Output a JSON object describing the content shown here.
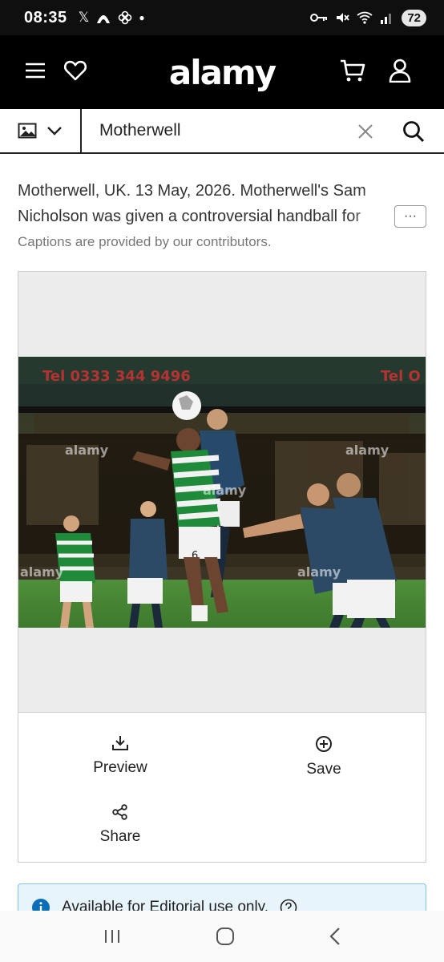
{
  "status_bar": {
    "time": "08:35",
    "battery": "72",
    "left_icons": [
      "x-icon",
      "app-icon",
      "flower-icon",
      "dot-icon"
    ],
    "right_icons": [
      "key-icon",
      "mute-icon",
      "wifi-icon",
      "signal-icon"
    ]
  },
  "header": {
    "logo": "alamy",
    "left_icons": [
      "menu-icon",
      "heart-icon"
    ],
    "right_icons": [
      "cart-icon",
      "account-icon"
    ]
  },
  "search": {
    "type_icon": "image-icon",
    "query": "Motherwell",
    "placeholder": ""
  },
  "caption": {
    "text": "Motherwell, UK. 13 May, 2026. Motherwell's Sam Nicholson was given a controversial handball for",
    "more_label": "···",
    "contributors_note": "Captions are provided by our contributors."
  },
  "image": {
    "watermarks": [
      "alamy",
      "alamy",
      "alamy",
      "alamy",
      "alamy"
    ],
    "background_color": "#ececec"
  },
  "actions": {
    "preview_label": "Preview",
    "save_label": "Save",
    "share_label": "Share"
  },
  "notice": {
    "text": "Available for Editorial use only."
  },
  "colors": {
    "header_bg": "#000000",
    "notice_bg": "#e7f4fb",
    "notice_border": "#7fc4e3",
    "notice_icon": "#0a6fb8"
  }
}
